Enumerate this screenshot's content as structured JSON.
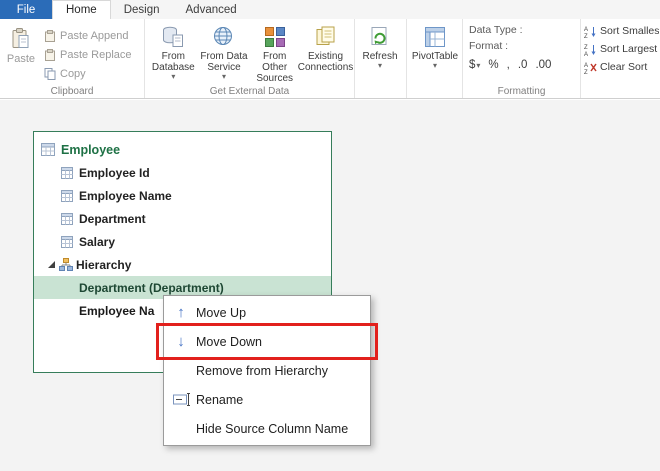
{
  "window": {
    "tabs": {
      "file": "File",
      "home": "Home",
      "design": "Design",
      "advanced": "Advanced"
    }
  },
  "ribbon": {
    "clipboard": {
      "paste": "Paste",
      "paste_append": "Paste Append",
      "paste_replace": "Paste Replace",
      "copy": "Copy",
      "group_label": "Clipboard"
    },
    "external_data": {
      "from_database_1": "From",
      "from_database_2": "Database",
      "from_service_1": "From Data",
      "from_service_2": "Service",
      "from_other_1": "From Other",
      "from_other_2": "Sources",
      "existing_1": "Existing",
      "existing_2": "Connections",
      "group_label": "Get External Data"
    },
    "refresh": "Refresh",
    "pivottable": "PivotTable",
    "formatting": {
      "data_type_label": "Data Type :",
      "format_label": "Format :",
      "currency": "$",
      "percent": "%",
      "comma": ",",
      "inc_decimal": ".0",
      "dec_decimal": ".00",
      "group_label": "Formatting"
    },
    "sort": {
      "smallest": "Sort Smalles",
      "largest": "Sort Largest",
      "clear": "Clear Sort"
    }
  },
  "panel": {
    "title": "Employee",
    "fields": [
      "Employee Id",
      "Employee Name",
      "Department",
      "Salary"
    ],
    "hierarchy": "Hierarchy",
    "child_selected": "Department (Department)",
    "child_partial": "Employee Na"
  },
  "context_menu": {
    "move_up": "Move Up",
    "move_down": "Move Down",
    "remove": "Remove from Hierarchy",
    "rename": "Rename",
    "hide_source": "Hide Source Column Name"
  },
  "colors": {
    "file_tab_blue": "#2b6cb8",
    "panel_green": "#217346",
    "selection_bg": "#c9e3d3",
    "annotation_red": "#e2201c",
    "menu_arrow_blue": "#4472c4"
  }
}
